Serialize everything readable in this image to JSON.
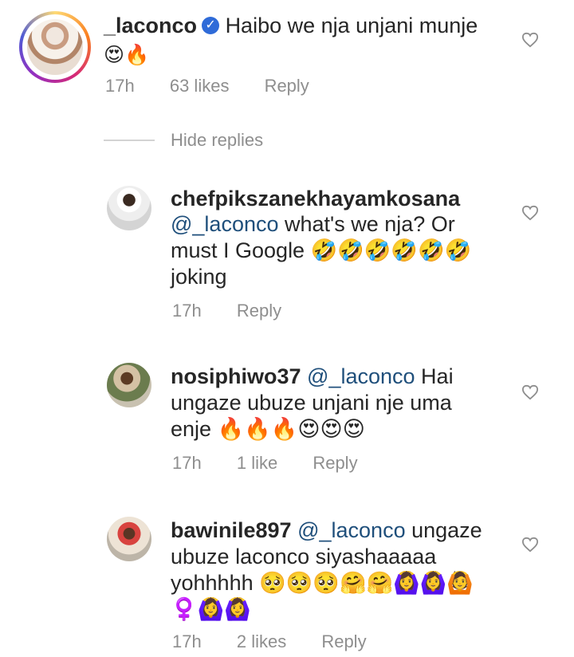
{
  "comments": [
    {
      "username": "_laconco",
      "verified": true,
      "text_line1": "Haibo we nja unjani munje",
      "text_line2": "😍🔥",
      "time": "17h",
      "likes": "63 likes",
      "reply": "Reply"
    },
    {
      "username": "chefpikszanekhayamkosana",
      "mention": "@_laconco",
      "text_line1": " what's we nja? Or",
      "text_line2": "must I Google 🤣🤣🤣🤣🤣🤣",
      "text_line3": "joking",
      "time": "17h",
      "reply": "Reply"
    },
    {
      "username": "nosiphiwo37",
      "mention": "@_laconco",
      "text_line1": " Hai",
      "text_line2": "ungaze ubuze unjani nje uma",
      "text_line3": "enje 🔥🔥🔥😍😍😍",
      "time": "17h",
      "likes": "1 like",
      "reply": "Reply"
    },
    {
      "username": "bawinile897",
      "mention": "@_laconco",
      "text_line1": " ungaze",
      "text_line2": "ubuze laconco siyashaaaaa",
      "text_line3": "yohhhhh 🥺🥺🥺🤗🤗🙆‍♀️🙆‍♀️🙆",
      "text_line4": "♀️🙆‍♀️🙆‍♀️",
      "time": "17h",
      "likes": "2 likes",
      "reply": "Reply"
    }
  ],
  "hide_replies": "Hide replies",
  "icons": {
    "verified": "verified-badge-icon",
    "heart": "heart-outline-icon"
  },
  "colors": {
    "mention": "#1f4f7b",
    "muted": "#8e8e8e",
    "verified": "#2f6bd8"
  }
}
